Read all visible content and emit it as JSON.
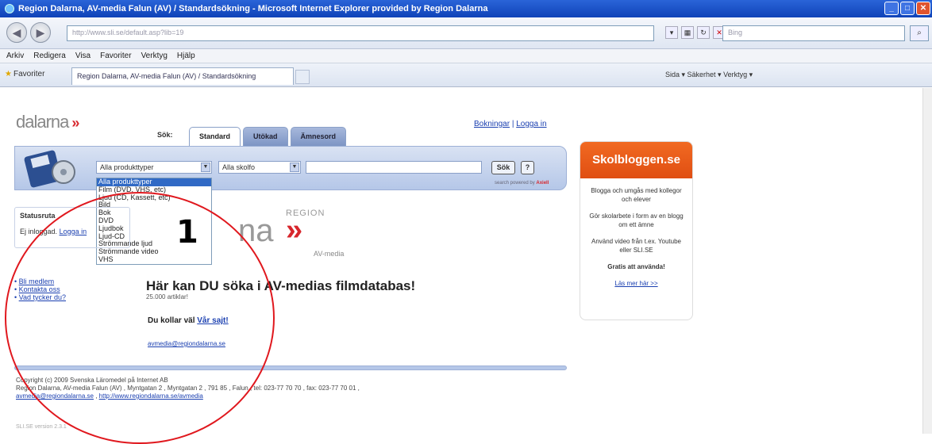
{
  "window": {
    "title": "Region Dalarna, AV-media Falun (AV) / Standardsökning - Microsoft Internet Explorer provided by Region Dalarna"
  },
  "browser": {
    "address": "http://www.sli.se/default.asp?lib=19",
    "search_placeholder": "Bing",
    "menu": [
      "Arkiv",
      "Redigera",
      "Visa",
      "Favoriter",
      "Verktyg",
      "Hjälp"
    ],
    "favorites_label": "Favoriter",
    "tab_title": "Region Dalarna, AV-media Falun (AV) / Standardsökning",
    "command_bar": "Sida ▾  Säkerhet ▾  Verktyg ▾"
  },
  "page": {
    "logo_text": "dalarna",
    "sok_label": "Sök:",
    "tabs": [
      "Standard",
      "Utökad",
      "Ämnesord"
    ],
    "top_links": {
      "bookings": "Bokningar",
      "separator": "|",
      "login": "Logga in"
    },
    "product_select_value": "Alla produkttyper",
    "school_select_value": "Alla skolfo",
    "sok_button": "Sök",
    "help_button": "?",
    "powered_by": "search powered by",
    "powered_by_brand": "Axiell",
    "dropdown_options": [
      "Alla produkttyper",
      "Film (DVD, VHS, etc)",
      "Ljud (CD, Kassett, etc)",
      "Bild",
      "Bok",
      "DVD",
      "Ljudbok",
      "Ljud-CD",
      "Strömmande ljud",
      "Strömmande video",
      "VHS"
    ],
    "status_heading": "Statusruta",
    "status_text": "Ej inloggad.",
    "status_login_link": "Logga in",
    "side_links": [
      "Bli medlem",
      "Kontakta oss",
      "Vad tycker du?"
    ],
    "region_logo_small": "REGION",
    "region_logo_big": "na",
    "av_media": "AV-media",
    "headline": "Här kan DU söka i AV-medias filmdatabas!",
    "article_count": "25.000 artiklar!",
    "du_kollar_prefix": "Du kollar väl",
    "du_kollar_link": "Vår sajt!",
    "email_link": "avmedia@regiondalarna.se",
    "footer_line1": "Copyright (c) 2009 Svenska Läromedel på Internet AB",
    "footer_line2": "Region Dalarna, AV-media Falun (AV) , Myntgatan 2 , Myntgatan 2 , 791 85 , Falun , tel: 023-77 70 70 , fax: 023-77 70 01 ,",
    "footer_link1": "avmedia@regiondalarna.se",
    "footer_sep": " , ",
    "footer_link2": "http://www.regiondalarna.se/avmedia",
    "version": "SLI.SE version 2.3.1"
  },
  "sidebar_ad": {
    "title": "Skolbloggen.se",
    "lines": [
      "Blogga och umgås med kollegor och elever",
      "Gör skolarbete i form av en blogg om ett ämne",
      "Använd video från t.ex. Youtube eller SLI.SE"
    ],
    "cta": "Gratis att använda!",
    "more": "Läs mer här >>"
  },
  "annotation": {
    "number": "1",
    "color": "#e0181e"
  }
}
